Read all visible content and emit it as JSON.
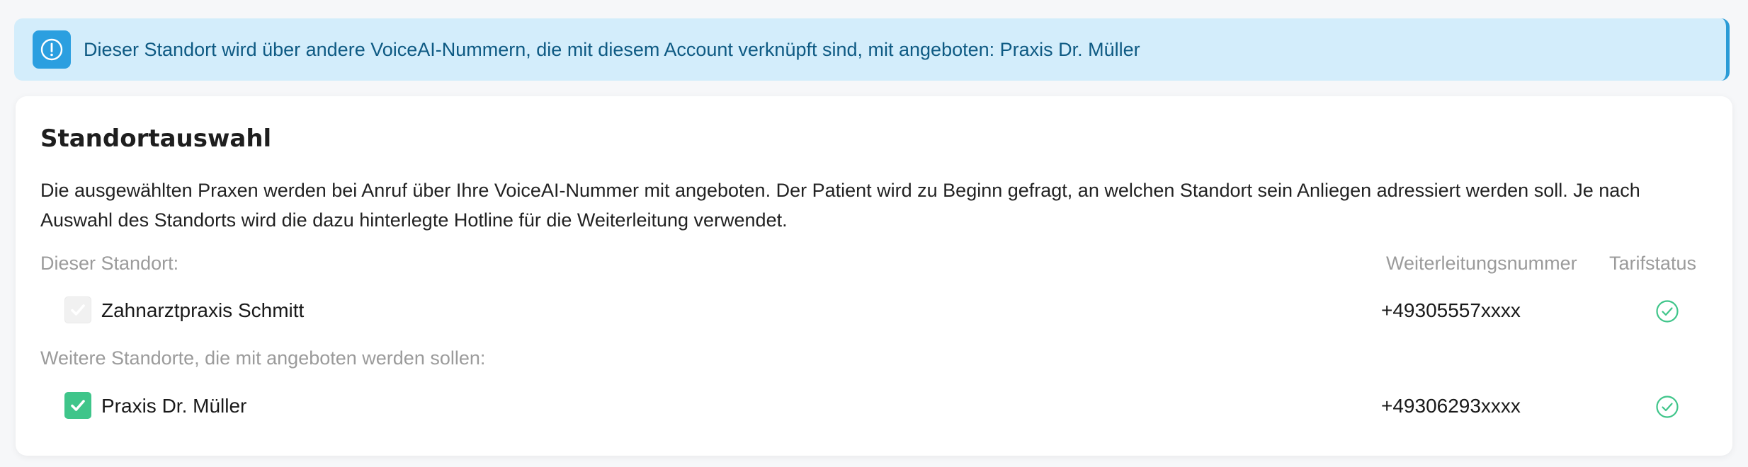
{
  "alert": {
    "icon": "info-icon",
    "text": "Dieser Standort wird über andere VoiceAI-Nummern, die mit diesem Account verknüpft sind, mit angeboten: Praxis Dr. Müller",
    "background_color": "#d3edfb",
    "accent_color": "#2b9fe0"
  },
  "card": {
    "title": "Standortauswahl",
    "description": "Die ausgewählten Praxen werden bei Anruf über Ihre VoiceAI-Nummer mit angeboten. Der Patient wird zu Beginn gefragt, an welchen Standort sein Anliegen adressiert werden soll. Je nach Auswahl des Standorts wird die dazu hinterlegte Hotline für die Weiterleitung verwendet.",
    "current_location_label": "Dieser Standort:",
    "columns": {
      "forwarding_number": "Weiterleitungsnummer",
      "tariff_status": "Tarifstatus"
    },
    "current_location": {
      "name": "Zahnarztpraxis Schmitt",
      "number": "+49305557xxxx",
      "checked": true,
      "disabled": true,
      "status_icon": "check-circle-icon"
    },
    "other_locations_label": "Weitere Standorte, die mit angeboten werden sollen:",
    "other_locations": [
      {
        "name": "Praxis Dr. Müller",
        "number": "+49306293xxxx",
        "checked": true,
        "disabled": false,
        "status_icon": "check-circle-icon"
      }
    ],
    "check_color": "#3fc58a"
  }
}
